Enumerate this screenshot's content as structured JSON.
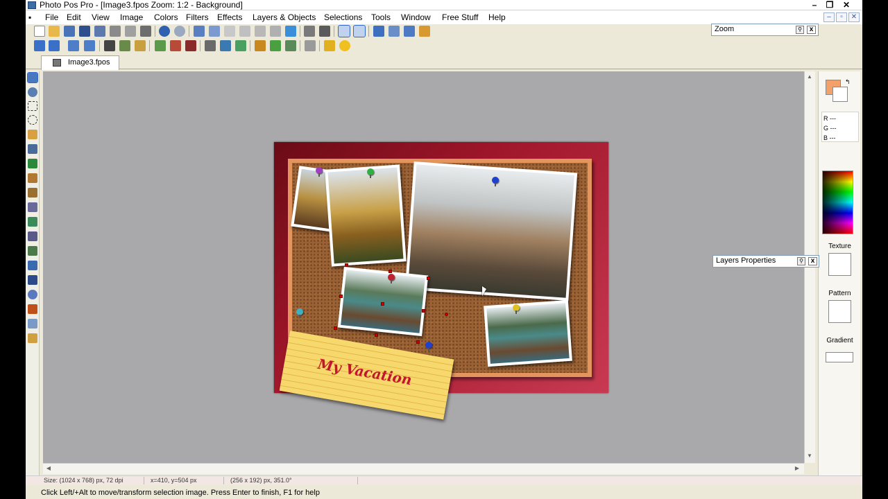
{
  "window": {
    "title": "Photo Pos Pro - [Image3.fpos  Zoom: 1:2 - Background]",
    "minimize": "–",
    "restore": "❐",
    "close": "✕"
  },
  "menu": [
    "File",
    "Edit",
    "View",
    "Image",
    "Colors",
    "Filters",
    "Effects",
    "Layers & Objects",
    "Selections",
    "Tools",
    "Window",
    "Free Stuff",
    "Help"
  ],
  "mdi_buttons": [
    "–",
    "▫",
    "✕"
  ],
  "zoom_panel": {
    "title": "Zoom",
    "pin": "⚲",
    "close": "x"
  },
  "tab": {
    "label": "Image3.fpos"
  },
  "image": {
    "note_text": "My Vacation",
    "colors": {
      "frame": "#a0162a",
      "cork": "#9a6134",
      "cork_border": "#e4945d",
      "note": "#f6d86c"
    }
  },
  "right_panel": {
    "r": "R ---",
    "g": "G ---",
    "b": "B ---",
    "texture": "Texture",
    "pattern": "Pattern",
    "gradient": "Gradient",
    "foreground_color": "#f4a06a",
    "background_color": "#ffffff"
  },
  "layers_panel": {
    "title": "Layers Properties",
    "pin": "⚲",
    "close": "x"
  },
  "status": {
    "size": "Size: (1024 x 768) px, 72 dpi",
    "coords": "x=410, y=504 px",
    "selection": "(256 x 192) px, 351.0°"
  },
  "hint": "Click Left/+Alt to move/transform selection image. Press Enter to finish, F1 for help"
}
